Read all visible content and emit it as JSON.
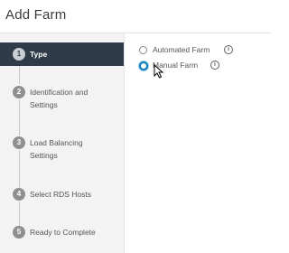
{
  "dialog": {
    "title": "Add Farm"
  },
  "wizard": {
    "steps": [
      {
        "num": "1",
        "label": "Type",
        "active": true
      },
      {
        "num": "2",
        "label": "Identification and Settings",
        "line1": "Identification and",
        "line2": "Settings"
      },
      {
        "num": "3",
        "label": "Load Balancing Settings",
        "line1": "Load Balancing",
        "line2": "Settings"
      },
      {
        "num": "4",
        "label": "Select RDS Hosts"
      },
      {
        "num": "5",
        "label": "Ready to Complete"
      }
    ]
  },
  "farm_type": {
    "options": [
      {
        "label": "Automated Farm",
        "selected": false,
        "info_icon": "info-icon"
      },
      {
        "label": "Manual Farm",
        "selected": true,
        "info_icon": "info-icon"
      }
    ]
  },
  "colors": {
    "active_step_bg": "#2f3b48",
    "radio_selected": "#0a7ab4",
    "sidebar_bg": "#f3f3f3"
  }
}
